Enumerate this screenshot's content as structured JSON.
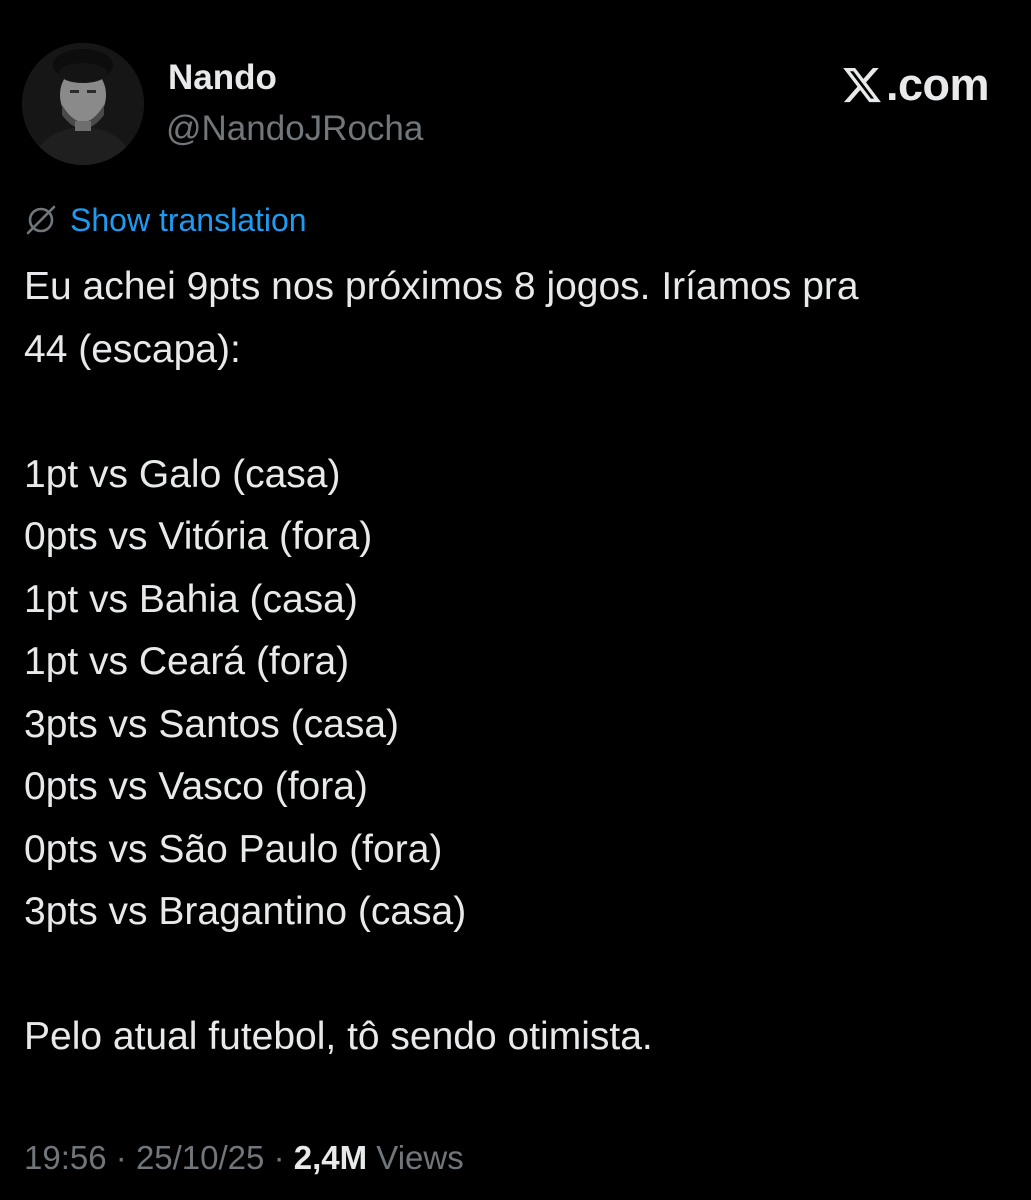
{
  "author": {
    "display_name": "Nando",
    "handle": "@NandoJRocha",
    "avatar_icon": "profile-photo"
  },
  "brand": {
    "icon": "x-logo-icon",
    "text": ".com"
  },
  "translation": {
    "icon": "globe-icon",
    "label": "Show translation",
    "color": "#1d9bf0"
  },
  "body": {
    "intro_lines": [
      "Eu achei 9pts nos próximos 8 jogos. Iríamos pra",
      "44 (escapa):"
    ],
    "games": [
      "1pt vs Galo (casa)",
      "0pts vs Vitória (fora)",
      "1pt vs Bahia (casa)",
      "1pt vs Ceará (fora)",
      "3pts vs Santos (casa)",
      "0pts vs Vasco (fora)",
      "0pts vs São Paulo (fora)",
      "3pts vs Bragantino (casa)"
    ],
    "closing": "Pelo atual futebol, tô sendo otimista."
  },
  "meta": {
    "time": "19:56",
    "separator": "·",
    "date": "25/10/25",
    "views_count": "2,4M",
    "views_label": "Views"
  },
  "colors": {
    "background": "#000000",
    "primary_text": "#e7e9ea",
    "secondary_text": "#71767b",
    "link": "#1d9bf0"
  }
}
